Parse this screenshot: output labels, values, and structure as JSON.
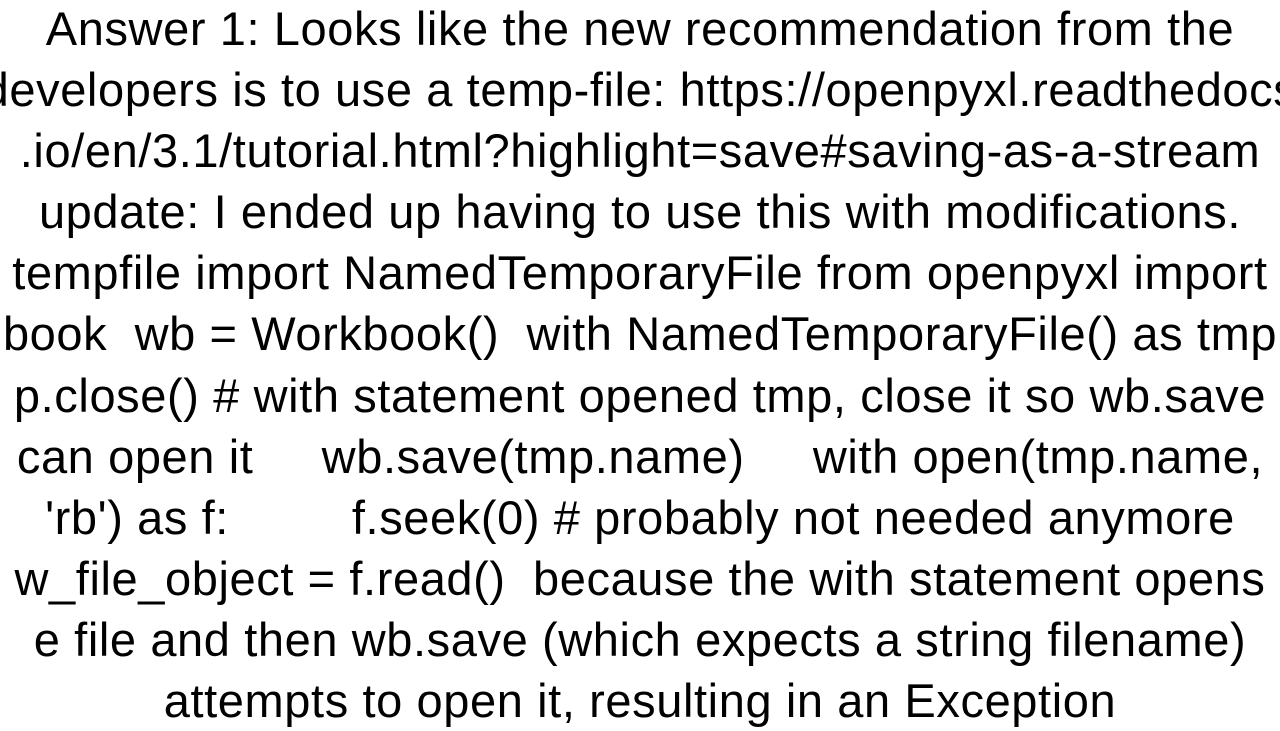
{
  "answer": {
    "label": "Answer 1:",
    "body_lines": [
      "Answer 1: Looks like the new recommendation from the",
      "developers is to use a temp-file: https://openpyxl.readthedocs",
      ".io/en/3.1/tutorial.html?highlight=save#saving-as-a-stream",
      "update: I ended up having to use this with modifications.",
      "tempfile import NamedTemporaryFile from openpyxl import",
      "book  wb = Workbook()  with NamedTemporaryFile() as tmp",
      "p.close() # with statement opened tmp, close it so wb.save",
      "can open it     wb.save(tmp.name)     with open(tmp.name,",
      "'rb') as f:         f.seek(0) # probably not needed anymore",
      "w_file_object = f.read()  because the with statement opens",
      "e file and then wb.save (which expects a string filename)",
      "attempts to open it, resulting in an Exception"
    ]
  }
}
